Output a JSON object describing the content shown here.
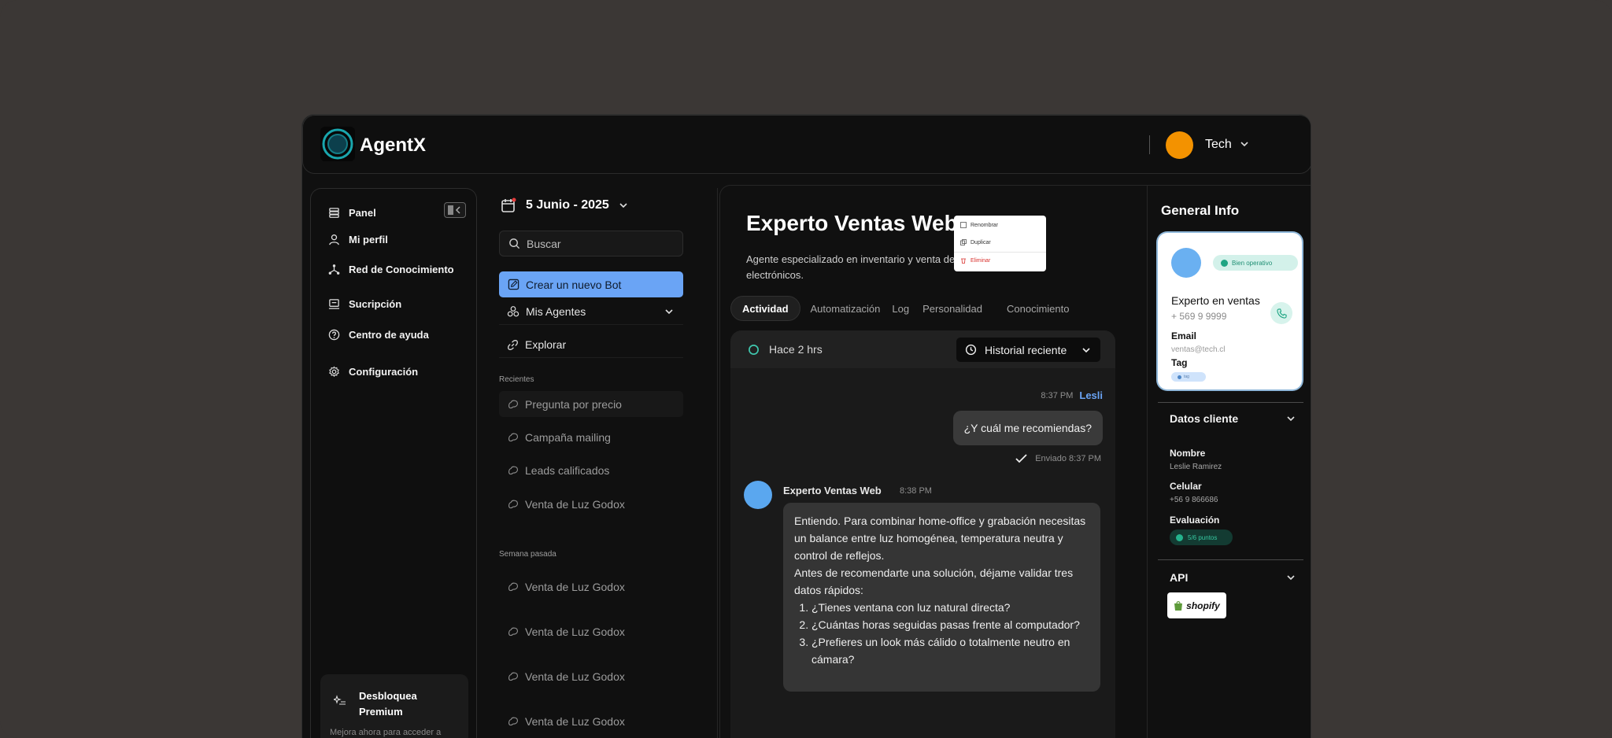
{
  "app": {
    "name": "AgentX"
  },
  "header": {
    "user_name": "Tech",
    "avatar_color": "#f39200"
  },
  "sidebar": {
    "items": [
      {
        "label": "Panel",
        "icon": "database-icon"
      },
      {
        "label": "Mi perfil",
        "icon": "user-icon"
      },
      {
        "label": "Red de Conocimiento",
        "icon": "network-icon"
      },
      {
        "label": "Sucripción",
        "icon": "subscription-icon"
      },
      {
        "label": "Centro de ayuda",
        "icon": "help-icon"
      },
      {
        "label": "Configuración",
        "icon": "gear-icon"
      }
    ],
    "premium": {
      "title": "Desbloquea Premium",
      "subtitle": "Mejora ahora para acceder a"
    }
  },
  "agents": {
    "date": "5 Junio - 2025",
    "search_placeholder": "Buscar",
    "new_bot_label": "Crear un nuevo Bot",
    "my_agents_label": "Mis Agentes",
    "explore_label": "Explorar",
    "recent_label": "Recientes",
    "recent": [
      "Pregunta por precio",
      "Campaña mailing",
      "Leads calificados",
      "Venta de Luz Godox"
    ],
    "last_week_label": "Semana pasada",
    "last_week": [
      "Venta de Luz Godox",
      "Venta de Luz Godox",
      "Venta de Luz Godox",
      "Venta de Luz Godox"
    ],
    "accent_color": "#6aa4f5"
  },
  "bot": {
    "title": "Experto Ventas Web",
    "description": "Agente especializado en inventario y venta de servicios electrónicos.",
    "menu": {
      "rename": "Renombrar",
      "duplicate": "Duplicar",
      "delete": "Eliminar"
    },
    "tabs": [
      "Actividad",
      "Automatización",
      "Log",
      "Personalidad",
      "Conocimiento"
    ]
  },
  "chat": {
    "elapsed": "Hace 2 hrs",
    "history_label": "Historial reciente",
    "user_msg": {
      "time": "8:37 PM",
      "name": "Lesli",
      "text": "¿Y cuál me recomiendas?",
      "status": "Enviado 8:37 PM"
    },
    "bot_msg": {
      "name": "Experto Ventas Web",
      "time": "8:38 PM",
      "p1": "Entiendo. Para combinar home-office y grabación necesitas un balance entre luz homogénea, temperatura neutra y control de reflejos.",
      "p2": "Antes de recomendarte una solución, déjame validar tres datos rápidos:",
      "list": [
        "¿Tienes ventana con luz natural directa?",
        "¿Cuántas horas seguidas pasas frente al computador?",
        "¿Prefieres un look más cálido o totalmente neutro en cámara?"
      ]
    }
  },
  "general_info": {
    "title": "General Info",
    "card": {
      "status": "Bien operativo",
      "role": "Experto en ventas",
      "phone": "+ 569 9 9999",
      "email_label": "Email",
      "email": "ventas@tech.cl",
      "tag_label": "Tag",
      "tag_value": "tag"
    },
    "client": {
      "title": "Datos cliente",
      "name_label": "Nombre",
      "name": "Leslie Ramirez",
      "cell_label": "Celular",
      "cell": "+56 9 866686",
      "eval_label": "Evaluación",
      "eval": "5/6 puntos"
    },
    "api": {
      "title": "API",
      "integration": "shopify"
    }
  }
}
